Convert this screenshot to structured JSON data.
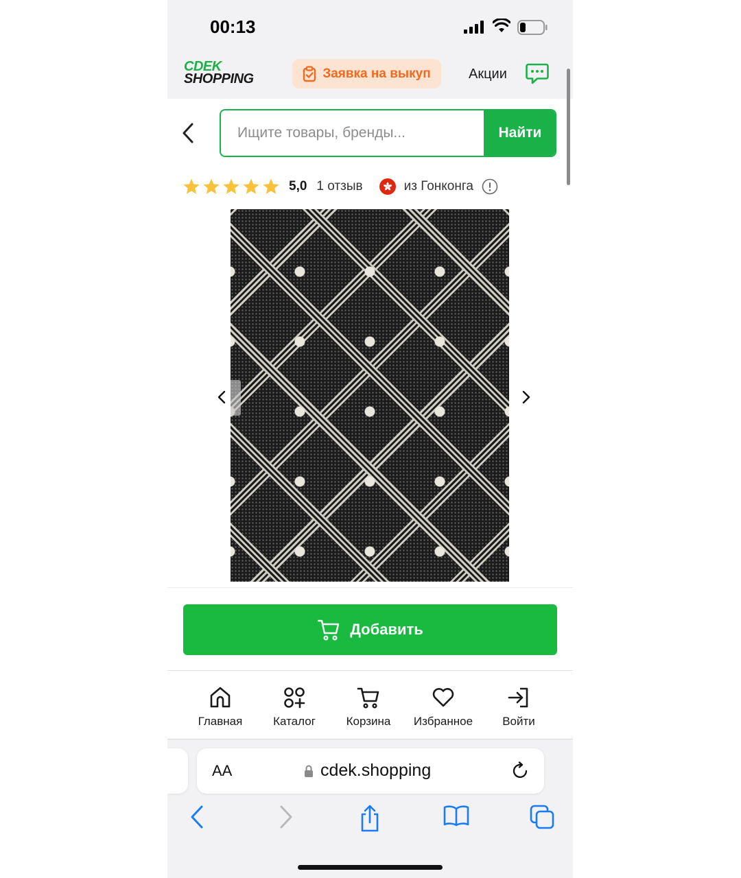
{
  "status_bar": {
    "time": "00:13"
  },
  "header": {
    "logo_top": "CDEK",
    "logo_bottom": "SHOPPING",
    "buyout_label": "Заявка на выкуп",
    "promo_label": "Акции"
  },
  "search": {
    "placeholder": "Ищите товары, бренды...",
    "value": "",
    "button_label": "Найти"
  },
  "product": {
    "rating_value": "5,0",
    "stars": 5,
    "reviews_label": "1 отзыв",
    "origin_label": "из Гонконга"
  },
  "cart": {
    "add_label": "Добавить"
  },
  "bottom_nav": {
    "items": [
      {
        "label": "Главная",
        "icon": "home-icon"
      },
      {
        "label": "Каталог",
        "icon": "catalog-icon"
      },
      {
        "label": "Корзина",
        "icon": "cart-icon"
      },
      {
        "label": "Избранное",
        "icon": "heart-icon"
      },
      {
        "label": "Войти",
        "icon": "login-icon"
      }
    ]
  },
  "browser": {
    "text_size_label": "AA",
    "url": "cdek.shopping"
  },
  "colors": {
    "brand_green": "#1ab248",
    "button_green": "#1ab93f",
    "buyout_orange": "#f06a1d",
    "buyout_bg": "#fde3d2",
    "star_yellow": "#f8c33a",
    "safari_blue": "#1a7cf5"
  }
}
